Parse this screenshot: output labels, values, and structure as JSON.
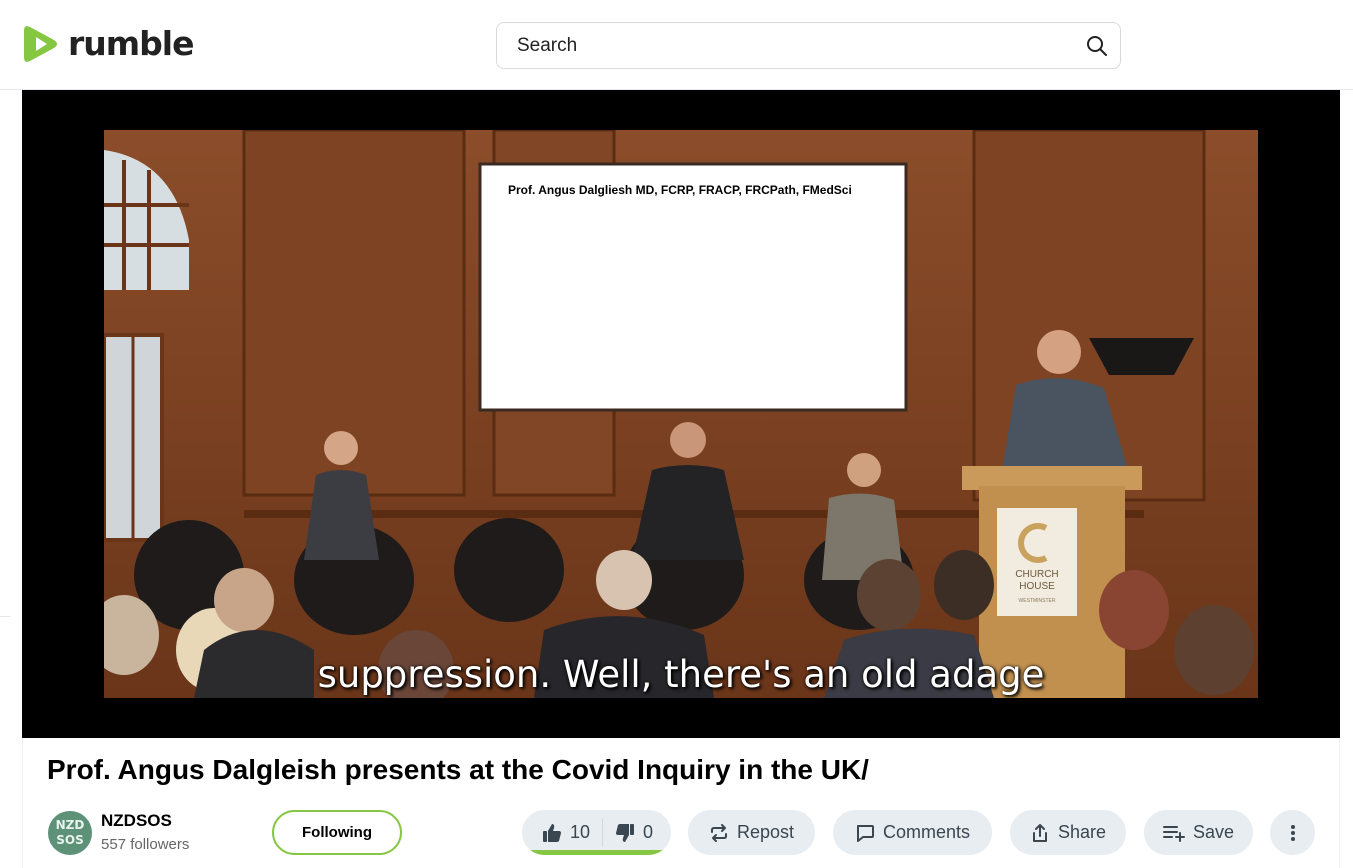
{
  "header": {
    "logo_text": "rumble",
    "search_placeholder": "Search"
  },
  "colors": {
    "brand_green": "#85c742",
    "pill_bg": "#e8edf1"
  },
  "video": {
    "slide_text": "Prof. Angus Dalgliesh MD, FCRP, FRACP, FRCPath, FMedSci",
    "podium_sign_line1": "CHURCH",
    "podium_sign_line2": "HOUSE",
    "podium_sign_line3": "WESTMINSTER",
    "subtitle": "suppression. Well, there's an old adage"
  },
  "title": "Prof. Angus Dalgleish presents at the Covid Inquiry in the UK/",
  "channel": {
    "avatar_line1": "NZD",
    "avatar_line2": "SOS",
    "name": "NZDSOS",
    "followers": "557 followers",
    "follow_label": "Following"
  },
  "actions": {
    "likes": "10",
    "dislikes": "0",
    "like_ratio": 1.0,
    "repost": "Repost",
    "comments": "Comments",
    "share": "Share",
    "save": "Save"
  }
}
